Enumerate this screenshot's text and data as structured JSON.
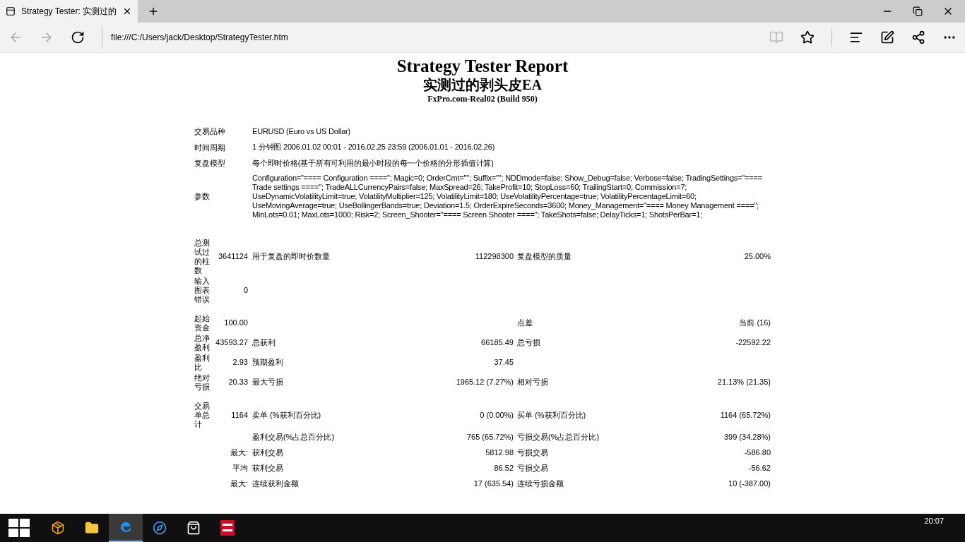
{
  "browser": {
    "tab_title": "Strategy Tester: 实测过的",
    "url": "file:///C:/Users/jack/Desktop/StrategyTester.htm"
  },
  "report": {
    "title": "Strategy Tester Report",
    "subtitle": "实测过的剥头皮EA",
    "server": "FxPro.com-Real02 (Build 950)",
    "info_rows": [
      {
        "label": "交易品种",
        "value": "EURUSD (Euro vs US Dollar)"
      },
      {
        "label": "时间周期",
        "value": "1 分钟图 2006.01.02 00:01 - 2016.02.25 23:59 (2006.01.01 - 2016.02.26)"
      },
      {
        "label": "复盘模型",
        "value": "每个即时价格(基于所有可利用的最小时段的每一个价格的分形插值计算)"
      },
      {
        "label": "参数",
        "value": "Configuration=\"==== Configuration ====\"; Magic=0; OrderCmt=\"\"; Suffix=\"\"; NDDmode=false; Show_Debug=false; Verbose=false; TradingSettings=\"==== Trade settings ====\"; TradeALLCurrencyPairs=false; MaxSpread=26; TakeProfit=10; StopLoss=60; TrailingStart=0; Commission=7; UseDynamicVolatilityLimit=true; VolatilityMultiplier=125; VolatilityLimit=180; UseVolatilityPercentage=true; VolatilityPercentageLimit=60; UseMovingAverage=true; UseBollingerBands=true; Deviation=1.5; OrderExpireSeconds=3600; Money_Management=\"==== Money Management ====\"; MinLots=0.01; MaxLots=1000; Risk=2; Screen_Shooter=\"==== Screen Shooter ====\"; TakeShots=false; DelayTicks=1; ShotsPerBar=1;"
      }
    ],
    "stat_sections": [
      [
        {
          "label": "总测试过的柱数",
          "value": "3641124",
          "label_2": "用于复盘的即时价数量",
          "value_2": "112298300",
          "label_3": "复盘模型的质量",
          "value_3": "25.00%"
        },
        {
          "label": "输入图表错误",
          "value": "0"
        }
      ],
      [
        {
          "label": "起始资金",
          "value": "100.00",
          "label_3": "点差",
          "value_3": "当前 (16)"
        },
        {
          "label": "总净盈利",
          "value": "43593.27",
          "label_2": "总获利",
          "value_2": "66185.49",
          "label_3": "总亏损",
          "value_3": "-22592.22"
        },
        {
          "label": "盈利比",
          "value": "2.93",
          "label_2": "预期盈利",
          "value_2": "37.45"
        },
        {
          "label": "绝对亏损",
          "value": "20.33",
          "label_2": "最大亏损",
          "value_2": "1965.12 (7.27%)",
          "label_3": "相对亏损",
          "value_3": "21.13% (21.35)"
        }
      ],
      [
        {
          "label": "交易单总计",
          "value": "1164",
          "label_2": "卖单 (%获利百分比)",
          "value_2": "0 (0.00%)",
          "label_3": "买单 (%获利百分比)",
          "value_3": "1164 (65.72%)"
        },
        {
          "label_2": "盈利交易(%占总百分比)",
          "value_2": "765 (65.72%)",
          "label_3": "亏损交易(%占总百分比)",
          "value_3": "399 (34.28%)"
        },
        {
          "value": "最大:",
          "label_2": "获利交易",
          "value_2": "5812.98",
          "label_3": "亏损交易",
          "value_3": "-586.80"
        },
        {
          "value": "平均",
          "label_2": "获利交易",
          "value_2": "86.52",
          "label_3": "亏损交易",
          "value_3": "-56.62"
        },
        {
          "value": "最大:",
          "label_2": "连续获利金额",
          "value_2": "17 (635.54)",
          "label_3": "连续亏损金额",
          "value_3": "10 (-387.00)"
        }
      ]
    ]
  },
  "taskbar": {
    "apps": [
      {
        "kind": "package",
        "selected": false
      },
      {
        "kind": "folder",
        "selected": false
      },
      {
        "kind": "edge",
        "selected": true
      },
      {
        "kind": "compass",
        "selected": false
      },
      {
        "kind": "store",
        "selected": false
      },
      {
        "kind": "fxpro",
        "selected": false
      }
    ],
    "clock": "20:07"
  }
}
